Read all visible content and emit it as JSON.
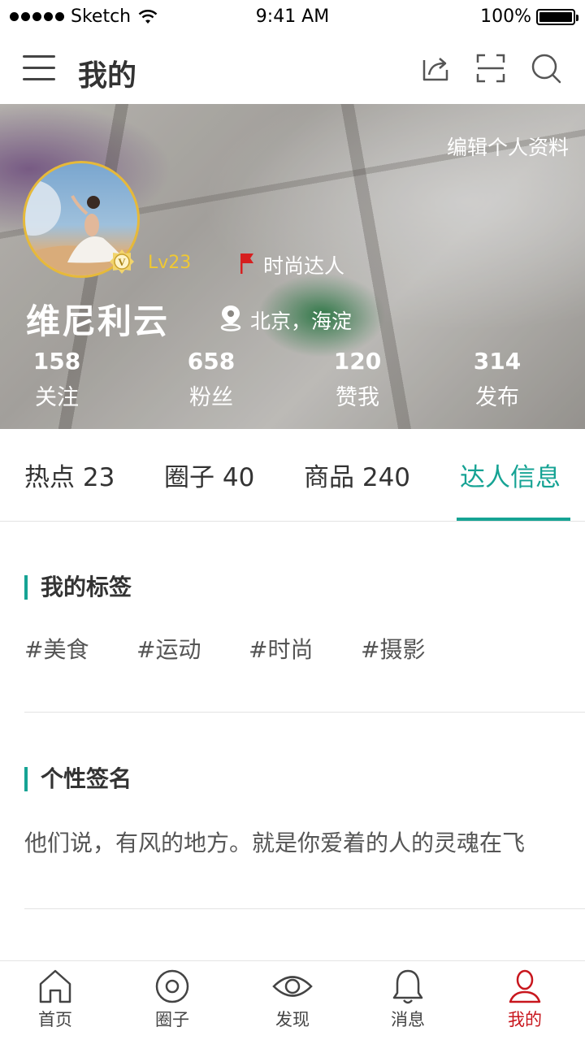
{
  "status_bar": {
    "carrier": "Sketch",
    "time": "9:41 AM",
    "battery": "100%"
  },
  "nav": {
    "title": "我的",
    "icons": [
      "menu-icon",
      "share-icon",
      "scan-icon",
      "search-icon"
    ]
  },
  "profile": {
    "edit_label": "编辑个人资料",
    "level": "Lv23",
    "title_badge": "时尚达人",
    "username": "维尼利云",
    "location": "北京，海淀",
    "stats": [
      {
        "value": "158",
        "label": "关注"
      },
      {
        "value": "658",
        "label": "粉丝"
      },
      {
        "value": "120",
        "label": "赞我"
      },
      {
        "value": "314",
        "label": "发布"
      }
    ]
  },
  "tabs": [
    {
      "label": "热点 23"
    },
    {
      "label": "圈子 40"
    },
    {
      "label": "商品 240"
    },
    {
      "label": "达人信息"
    }
  ],
  "tags_section": {
    "title": "我的标签",
    "tags": [
      "#美食",
      "#运动",
      "#时尚",
      "#摄影"
    ]
  },
  "signature_section": {
    "title": "个性签名",
    "text": "他们说，有风的地方。就是你爱着的人的灵魂在飞"
  },
  "tab_bar": {
    "items": [
      {
        "label": "首页",
        "icon": "home-icon"
      },
      {
        "label": "圈子",
        "icon": "circle-icon"
      },
      {
        "label": "发现",
        "icon": "eye-icon"
      },
      {
        "label": "消息",
        "icon": "bell-icon"
      },
      {
        "label": "我的",
        "icon": "user-icon"
      }
    ]
  },
  "colors": {
    "accent": "#16a394",
    "active_tab_bar": "#c8161d",
    "level": "#f0c832"
  }
}
